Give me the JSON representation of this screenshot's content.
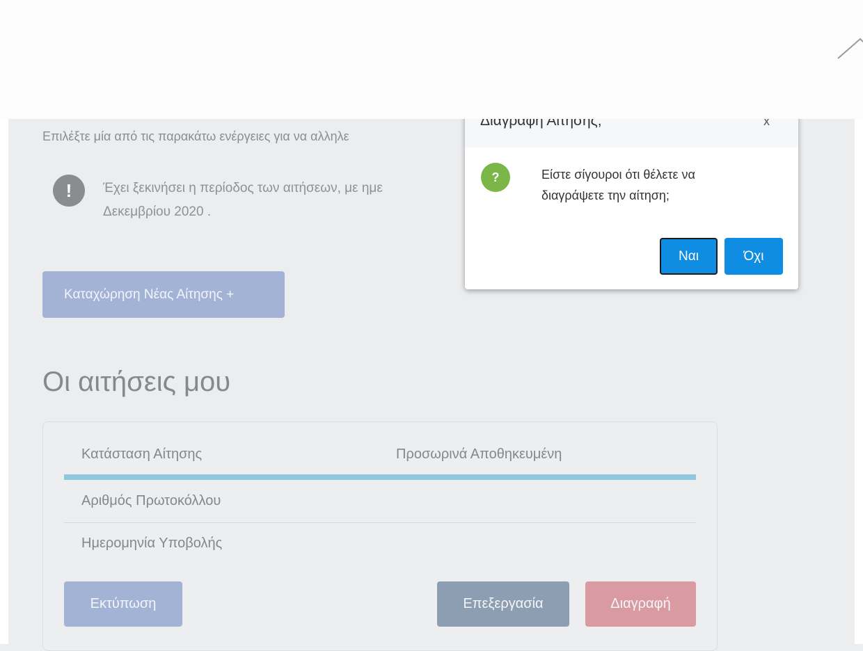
{
  "page": {
    "intro": "Επιλέξτε μία από τις παρακάτω ενέργειες για να αλληλε",
    "info_line1": "Έχει ξεκινήσει η περίοδος των αιτήσεων, με ημε",
    "info_line2": "Δεκεμβρίου 2020 .",
    "new_application_button": "Καταχώρηση Νέας Αίτησης +",
    "section_title": "Οι αιτήσεις μου"
  },
  "application": {
    "status_label": "Κατάσταση Αίτησης",
    "status_value": "Προσωρινά Αποθηκευμένη",
    "protocol_label": "Αριθμός Πρωτοκόλλου",
    "submission_date_label": "Ημερομηνία Υποβολής"
  },
  "actions": {
    "print": "Εκτύπωση",
    "edit": "Επεξεργασία",
    "delete": "Διαγραφή"
  },
  "dialog": {
    "title": "Διαγραφή Αίτησης;",
    "close": "x",
    "message": "Είστε σίγουροι ότι θέλετε να διαγράψετε την αίτηση;",
    "yes": "Ναι",
    "no": "Όχι"
  },
  "icons": {
    "info": "exclamation-circle-icon",
    "question": "question-circle-icon",
    "collapse": "chevron-up-icon"
  },
  "colors": {
    "primary": "#0f8de2",
    "status_bar": "#8fc7dd",
    "question_icon": "#7ab648"
  }
}
